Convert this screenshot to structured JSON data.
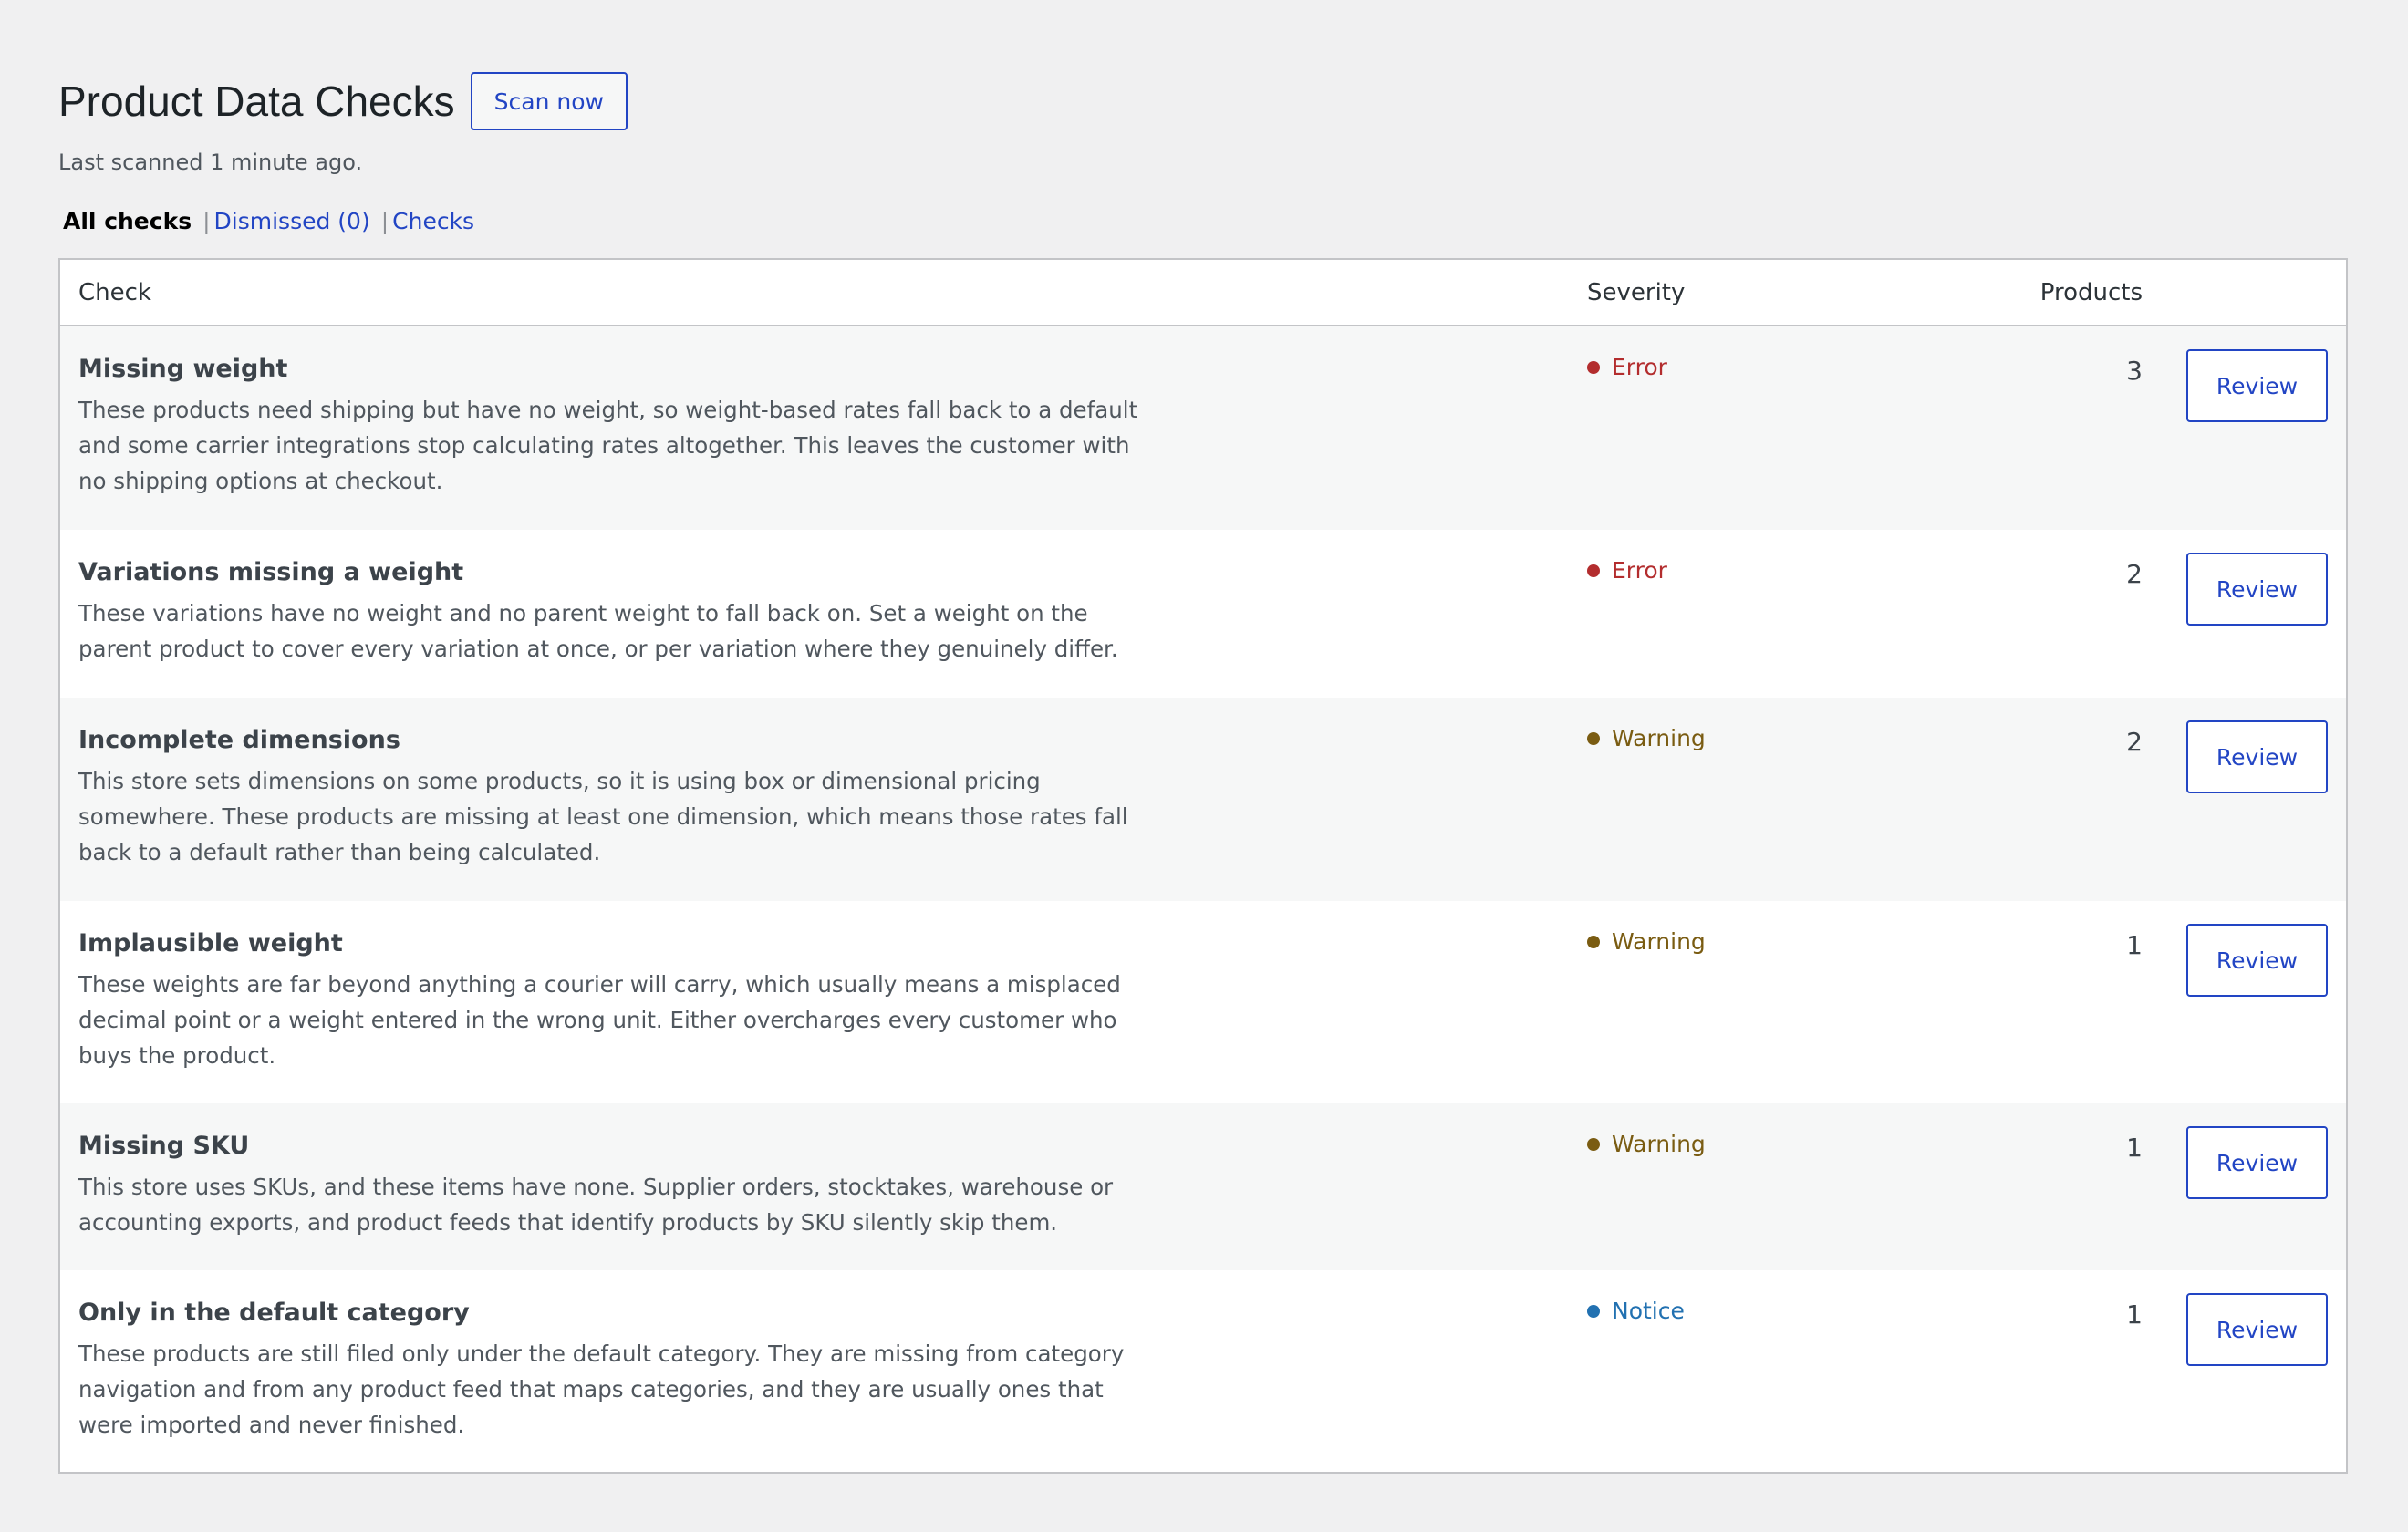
{
  "header": {
    "title": "Product Data Checks",
    "scan_label": "Scan now",
    "last_scanned": "Last scanned 1 minute ago."
  },
  "filters": {
    "all_label": "All checks",
    "sep": "|",
    "dismissed_label": "Dismissed (0)",
    "checks_label": "Checks"
  },
  "table": {
    "columns": {
      "check": "Check",
      "severity": "Severity",
      "products": "Products"
    },
    "rows": [
      {
        "title": "Missing weight",
        "desc": "These products need shipping but have no weight, so weight-based rates fall back to a default and some carrier integrations stop calculating rates altogether. This leaves the customer with no shipping options at checkout.",
        "severity": "Error",
        "count": "3",
        "action": "Review"
      },
      {
        "title": "Variations missing a weight",
        "desc": "These variations have no weight and no parent weight to fall back on. Set a weight on the parent product to cover every variation at once, or per variation where they genuinely differ.",
        "severity": "Error",
        "count": "2",
        "action": "Review"
      },
      {
        "title": "Incomplete dimensions",
        "desc": "This store sets dimensions on some products, so it is using box or dimensional pricing somewhere. These products are missing at least one dimension, which means those rates fall back to a default rather than being calculated.",
        "severity": "Warning",
        "count": "2",
        "action": "Review"
      },
      {
        "title": "Implausible weight",
        "desc": "These weights are far beyond anything a courier will carry, which usually means a misplaced decimal point or a weight entered in the wrong unit. Either overcharges every customer who buys the product.",
        "severity": "Warning",
        "count": "1",
        "action": "Review"
      },
      {
        "title": "Missing SKU",
        "desc": "This store uses SKUs, and these items have none. Supplier orders, stocktakes, warehouse or accounting exports, and product feeds that identify products by SKU silently skip them.",
        "severity": "Warning",
        "count": "1",
        "action": "Review"
      },
      {
        "title": "Only in the default category",
        "desc": "These products are still filed only under the default category. They are missing from category navigation and from any product feed that maps categories, and they are usually ones that were imported and never finished.",
        "severity": "Notice",
        "count": "1",
        "action": "Review"
      }
    ]
  },
  "colors": {
    "error": "#b32d2e",
    "warning": "#7a5c12",
    "notice": "#2271b1",
    "accent": "#2245c4"
  }
}
